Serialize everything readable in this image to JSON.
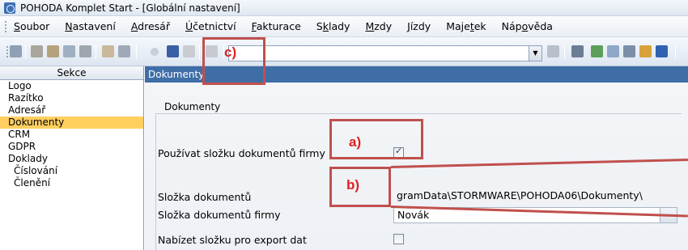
{
  "window": {
    "title": "POHODA Komplet Start - [Globální nastavení]"
  },
  "menu": [
    {
      "pre": "",
      "u": "S",
      "post": "oubor"
    },
    {
      "pre": "",
      "u": "N",
      "post": "astavení"
    },
    {
      "pre": "",
      "u": "A",
      "post": "dresář"
    },
    {
      "pre": "",
      "u": "Ú",
      "post": "četnictví"
    },
    {
      "pre": "",
      "u": "F",
      "post": "akturace"
    },
    {
      "pre": "S",
      "u": "k",
      "post": "lady"
    },
    {
      "pre": "",
      "u": "M",
      "post": "zdy"
    },
    {
      "pre": "",
      "u": "J",
      "post": "ízdy"
    },
    {
      "pre": "Maje",
      "u": "t",
      "post": "ek"
    },
    {
      "pre": "Náp",
      "u": "o",
      "post": "věda"
    }
  ],
  "toolbar": {
    "combo_value": ""
  },
  "sidebar": {
    "header": "Sekce",
    "items": [
      {
        "label": "Logo",
        "sub": false,
        "selected": false
      },
      {
        "label": "Razítko",
        "sub": false,
        "selected": false
      },
      {
        "label": "Adresář",
        "sub": false,
        "selected": false
      },
      {
        "label": "Dokumenty",
        "sub": false,
        "selected": true
      },
      {
        "label": "CRM",
        "sub": false,
        "selected": false
      },
      {
        "label": "GDPR",
        "sub": false,
        "selected": false
      },
      {
        "label": "Doklady",
        "sub": false,
        "selected": false
      },
      {
        "label": "Číslování",
        "sub": true,
        "selected": false
      },
      {
        "label": "Členění",
        "sub": true,
        "selected": false
      }
    ]
  },
  "main": {
    "header": "Dokumenty",
    "group_title": "Dokumenty",
    "use_company_folder_label": "Používat složku dokumentů firmy",
    "use_company_folder_checked": true,
    "documents_folder_label": "Složka dokumentů",
    "documents_folder_value": "gramData\\STORMWARE\\POHODA06\\Dokumenty\\",
    "company_folder_label": "Složka dokumentů firmy",
    "company_folder_value": "Novák",
    "export_folder_label": "Nabízet složku pro export dat",
    "export_folder_checked": false
  },
  "annotations": {
    "a": "a)",
    "b": "b)",
    "c": "c)",
    "color": "#c0504d",
    "text_color": "#e02020"
  }
}
